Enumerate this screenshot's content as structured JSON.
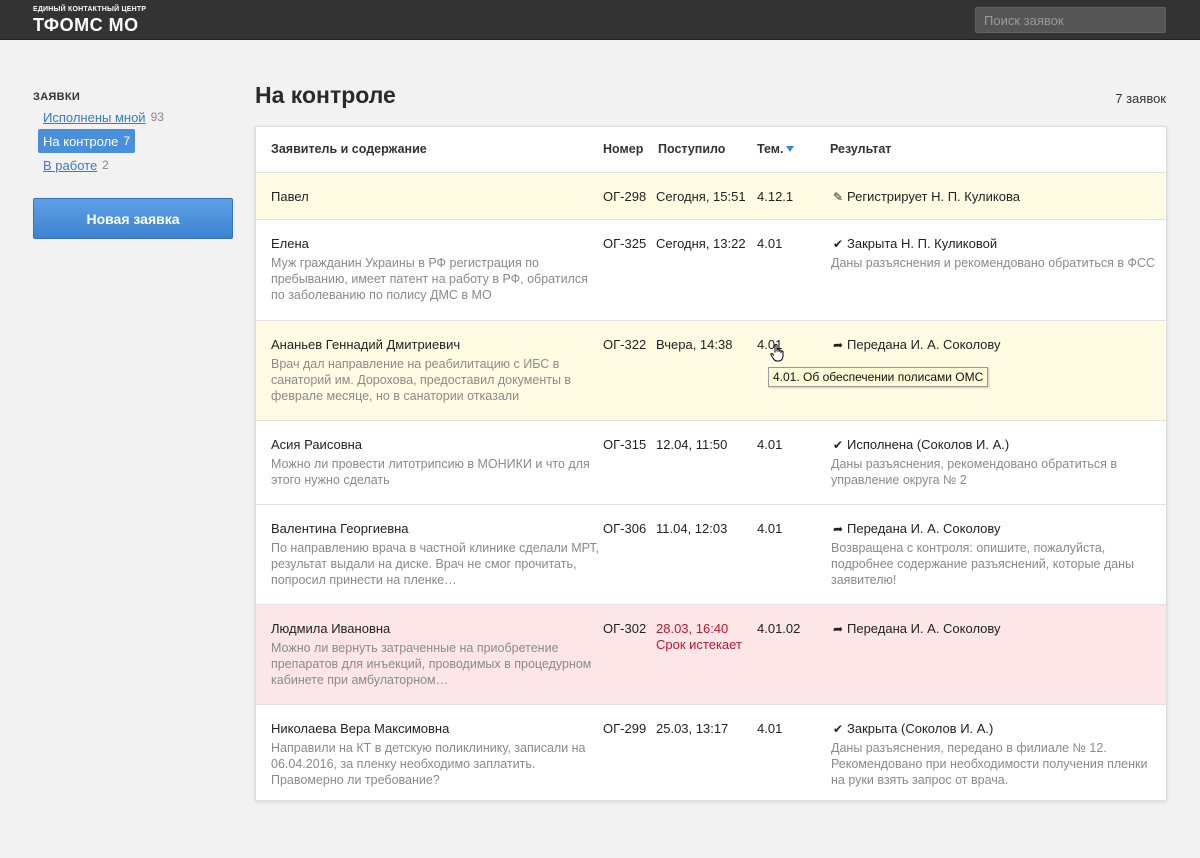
{
  "brand": {
    "subtitle": "ЕДИНЫЙ КОНТАКТНЫЙ ЦЕНТР",
    "title": "ТФОМС МО"
  },
  "search": {
    "placeholder": "Поиск заявок"
  },
  "sidebar": {
    "heading": "ЗАЯВКИ",
    "items": [
      {
        "label": "Исполнены мной",
        "count": "93",
        "active": false
      },
      {
        "label": "На контроле",
        "count": "7",
        "active": true
      },
      {
        "label": "В работе",
        "count": "2",
        "active": false
      }
    ],
    "new_button": "Новая заявка"
  },
  "main": {
    "title": "На контроле",
    "count": "7 заявок",
    "columns": {
      "applicant": "Заявитель и содержание",
      "number": "Номер",
      "received": "Поступило",
      "theme": "Тем.",
      "result": "Результат"
    },
    "rows": [
      {
        "name": "Павел",
        "desc": "",
        "number": "OГ-298",
        "date": "Сегодня, 15:51",
        "deadline": "",
        "theme": "4.12.1",
        "result_icon": "pencil-icon",
        "result": "Регистрирует Н. П. Куликова",
        "note": ""
      },
      {
        "name": "Елена",
        "desc": "Муж гражданин Украины в РФ регистрация по пребыванию, имеет патент на работу в РФ, обратился по заболеванию по полису ДМС в МО",
        "number": "OГ-325",
        "date": "Сегодня, 13:22",
        "deadline": "",
        "theme": "4.01",
        "result_icon": "check-icon",
        "result": "Закрыта Н. П. Куликовой",
        "note": "Даны разъяснения и рекомендовано обратиться в ФСС"
      },
      {
        "name": "Ананьев Геннадий Дмитриевич",
        "desc": "Врач дал направление на реабилитацию с ИБС в санаторий им. Дорохова, предоставил документы в феврале месяце, но в санатории отказали",
        "number": "OГ-322",
        "date": "Вчера, 14:38",
        "deadline": "",
        "theme": "4.01",
        "result_icon": "forward-icon",
        "result": "Передана И. А. Соколову",
        "note": ""
      },
      {
        "name": "Асия Раисовна",
        "desc": "Можно ли провести литотрипсию в МОНИКИ и что для этого нужно сделать",
        "number": "OГ-315",
        "date": "12.04, 11:50",
        "deadline": "",
        "theme": "4.01",
        "result_icon": "check-icon",
        "result": "Исполнена (Соколов И. А.)",
        "note": "Даны разъяснения, рекомендовано обратиться в управление округа № 2"
      },
      {
        "name": "Валентина Георгиевна",
        "desc": "По направлению врача в частной клинике сделали МРТ, результат выдали на диске. Врач не смог прочитать, попросил принести на пленке…",
        "number": "OГ-306",
        "date": "11.04, 12:03",
        "deadline": "",
        "theme": "4.01",
        "result_icon": "forward-icon",
        "result": "Передана И. А. Соколову",
        "note": "Возвращена с контроля: опишите, пожалуйста, подробнее содержание разъяснений, которые даны заявителю!"
      },
      {
        "name": "Людмила Ивановна",
        "desc": "Можно ли вернуть затраченные на приобретение препаратов для инъекций, проводимых в процедурном кабинете при амбулаторном…",
        "number": "OГ-302",
        "date": "28.03, 16:40",
        "deadline": "Срок истекает",
        "theme": "4.01.02",
        "result_icon": "forward-icon",
        "result": "Передана И. А. Соколову",
        "note": ""
      },
      {
        "name": "Николаева Вера Максимовна",
        "desc": "Направили на КТ в детскую поликлинику, записали на 06.04.2016, за пленку необходимо заплатить. Правомерно ли требование?",
        "number": "OГ-299",
        "date": "25.03, 13:17",
        "deadline": "",
        "theme": "4.01",
        "result_icon": "check-icon",
        "result": "Закрыта (Соколов И. А.)",
        "note": "Даны разъяснения, передано в филиале № 12. Рекомендовано при необходимости получения пленки на руки взять запрос от врача."
      }
    ],
    "tooltip": "4.01. Об обеспечении полисами ОМС"
  }
}
